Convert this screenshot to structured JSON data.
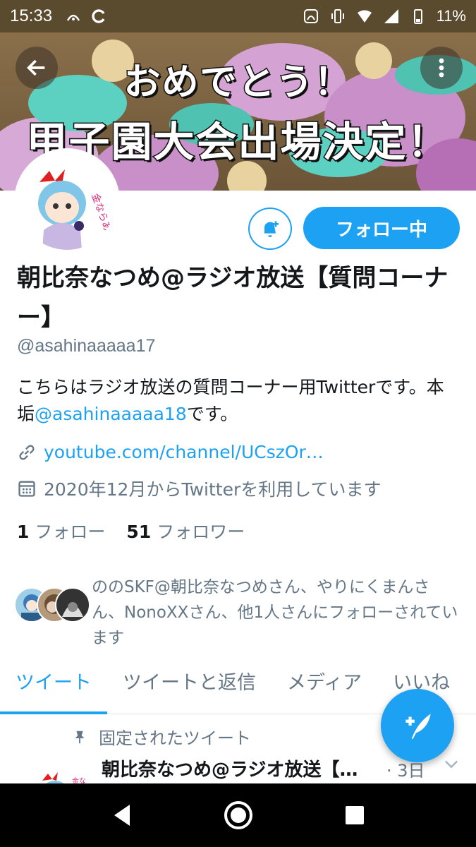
{
  "status_bar": {
    "time": "15:33",
    "battery": "11%"
  },
  "banner": {
    "line1": "おめでとう！",
    "line2": "甲子園大会出場決定！"
  },
  "profile": {
    "display_name": "朝比奈なつめ@ラジオ放送【質問コーナー】",
    "handle": "@asahinaaaaa17",
    "bio_prefix": "こちらはラジオ放送の質問コーナー用Twitterです。本垢",
    "bio_mention": "@asahinaaaaa18",
    "bio_suffix": "です。",
    "link": "youtube.com/channel/UCszOr…",
    "joined": "2020年12月からTwitterを利用しています",
    "following_count": "1",
    "following_label": "フォロー",
    "followers_count": "51",
    "followers_label": "フォロワー",
    "followed_by": "ののSKF@朝比奈なつめさん、やりにくまんさん、NonoXXさん、他1人さんにフォローされています"
  },
  "buttons": {
    "follow_label": "フォロー中"
  },
  "tabs": [
    {
      "label": "ツイート"
    },
    {
      "label": "ツイートと返信"
    },
    {
      "label": "メディア"
    },
    {
      "label": "いいね"
    }
  ],
  "pinned": {
    "label": "固定されたツイート",
    "name": "朝比奈なつめ@ラジオ放送【…",
    "time": "· 3日"
  },
  "colors": {
    "accent": "#1da1f2",
    "secondary_text": "#657786"
  }
}
